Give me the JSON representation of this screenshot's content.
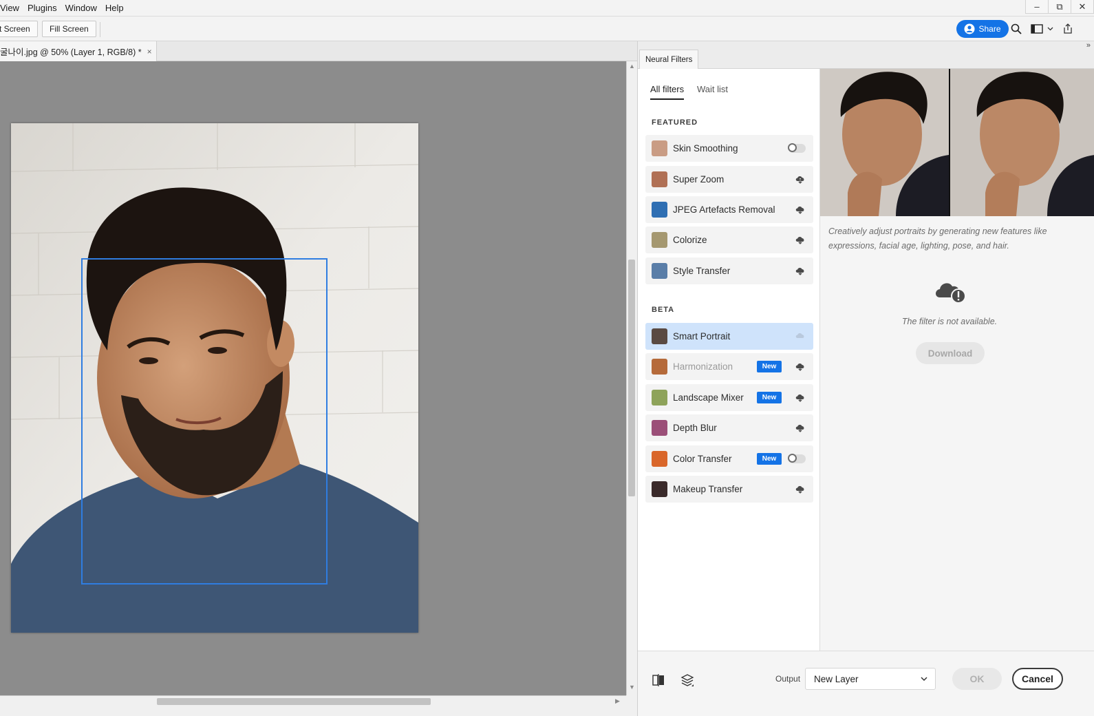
{
  "menu": [
    "View",
    "Plugins",
    "Window",
    "Help"
  ],
  "window_controls": {
    "minimize": "–",
    "restore": "⧉",
    "close": "✕"
  },
  "options_bar": {
    "fit_screen": "t Screen",
    "fill_screen": "Fill Screen",
    "share": "Share"
  },
  "document": {
    "tab_title": "굴나이.jpg @ 50% (Layer 1, RGB/8) *",
    "close": "×"
  },
  "panel": {
    "title": "Neural Filters",
    "tabs": [
      "All filters",
      "Wait list"
    ],
    "featured_label": "FEATURED",
    "beta_label": "BETA",
    "featured": [
      {
        "label": "Skin Smoothing",
        "control": "toggle",
        "thumb_color": "#c99c84"
      },
      {
        "label": "Super Zoom",
        "control": "download",
        "thumb_color": "#b07055"
      },
      {
        "label": "JPEG Artefacts Removal",
        "control": "download",
        "thumb_color": "#2f6fb3"
      },
      {
        "label": "Colorize",
        "control": "download",
        "thumb_color": "#a59870"
      },
      {
        "label": "Style Transfer",
        "control": "download",
        "thumb_color": "#5a7ea8"
      }
    ],
    "beta": [
      {
        "label": "Smart Portrait",
        "control": "cloud",
        "selected": true,
        "thumb_color": "#5a4a42"
      },
      {
        "label": "Harmonization",
        "new": "New",
        "control": "download",
        "muted": true,
        "thumb_color": "#b56a3a"
      },
      {
        "label": "Landscape Mixer",
        "new": "New",
        "control": "download",
        "thumb_color": "#8ea35a"
      },
      {
        "label": "Depth Blur",
        "control": "download",
        "thumb_color": "#9b4f78"
      },
      {
        "label": "Color Transfer",
        "new": "New",
        "control": "toggle",
        "thumb_color": "#d9662a"
      },
      {
        "label": "Makeup Transfer",
        "control": "download",
        "thumb_color": "#3a2a2a"
      }
    ],
    "description": "Creatively adjust portraits by generating new features like expressions, facial age, lighting, pose, and hair.",
    "not_available": "The filter is not available.",
    "download": "Download",
    "output_label": "Output",
    "output_value": "New Layer",
    "ok": "OK",
    "cancel": "Cancel"
  },
  "colors": {
    "accent": "#1473e6",
    "selection": "#2f7de1",
    "canvas": "#8c8c8c"
  }
}
